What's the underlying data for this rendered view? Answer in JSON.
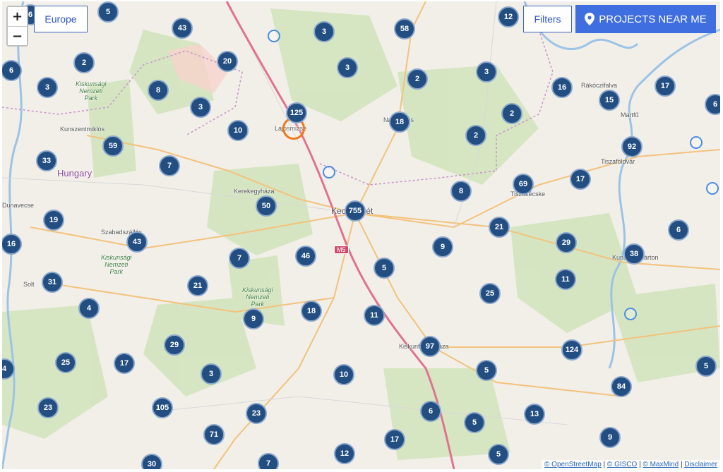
{
  "controls": {
    "zoom_in": "+",
    "zoom_out": "−",
    "region_button": "Europe",
    "filters_button": "Filters",
    "near_me_button": "PROJECTS NEAR ME"
  },
  "map_labels": {
    "kunszentmiklos": "Kunszentmiklós",
    "kiskunsagi_park_1": "Kiskunsági\nNemzeti\nPark",
    "kiskunsagi_park_2": "Kiskunsági\nNemzeti\nPark",
    "kiskunsagi_park_3": "Kiskunsági\nNemzeti\nPark",
    "hungary": "Hungary",
    "kerekegyhaza": "Kerekegyháza",
    "lajosmizse": "Lajosmizse",
    "kecskemet": "Kecskemét",
    "nagykoros": "Nagykőrös",
    "szabadszallas": "Szabadszállás",
    "solt": "Solt",
    "tiszakecske": "Tiszakécske",
    "tiszafoldvar": "Tiszaföldvár",
    "rakoczifalva": "Rákóczifalva",
    "martfu": "Martfű",
    "kunszentmarton": "Kunszentmárton",
    "kiskunfelegyhaza": "Kiskunfélegyháza",
    "dunavecse": "Dunavecse",
    "road_m5": "M5"
  },
  "clusters": [
    "6",
    "5",
    "43",
    "3",
    "58",
    "12",
    "2",
    "20",
    "3",
    "2",
    "3",
    "6",
    "3",
    "8",
    "3",
    "16",
    "17",
    "15",
    "6",
    "125",
    "18",
    "2",
    "2",
    "10",
    "59",
    "92",
    "33",
    "7",
    "69",
    "17",
    "8",
    "50",
    "755",
    "21",
    "6",
    "19",
    "43",
    "46",
    "7",
    "16",
    "29",
    "38",
    "9",
    "5",
    "31",
    "21",
    "11",
    "4",
    "18",
    "11",
    "25",
    "9",
    "29",
    "97",
    "124",
    "17",
    "25",
    "3",
    "10",
    "5",
    "4",
    "23",
    "105",
    "23",
    "6",
    "13",
    "84",
    "71",
    "5",
    "17",
    "9",
    "12",
    "5",
    "30",
    "7",
    "5"
  ],
  "attribution": {
    "osm": "© OpenStreetMap",
    "gisco": "© GISCO",
    "maxmind": "© MaxMind",
    "disclaimer": "Disclaimer",
    "separator": " | "
  }
}
